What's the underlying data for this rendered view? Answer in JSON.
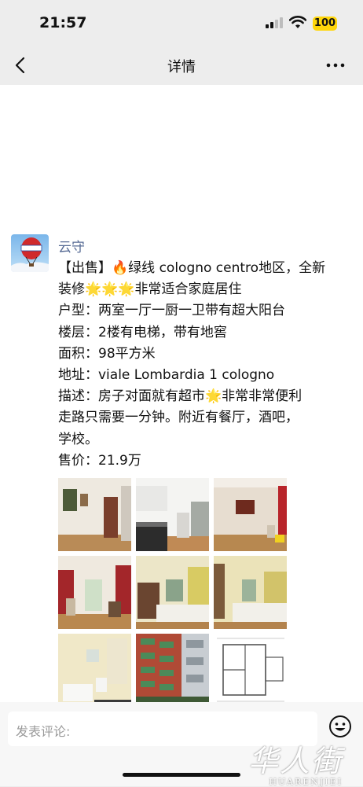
{
  "status_bar": {
    "time": "21:57",
    "battery": "100"
  },
  "nav": {
    "title": "详情"
  },
  "post": {
    "author": "云守",
    "lines": [
      "【出售】🔥绿线 cologno centro地区，全新",
      "装修🌟🌟🌟非常适合家庭居住",
      "户型：两室一厅一厨一卫带有超大阳台",
      "楼层：2楼有电梯，带有地窖",
      "面积：98平方米",
      "地址：viale Lombardia 1 cologno",
      "描述：房子对面就有超市🌟非常非常便利",
      "走路只需要一分钟。附近有餐厅，酒吧，",
      "学校。",
      "售价：21.9万"
    ],
    "photos": [
      "hallway-photo",
      "kitchen-photo",
      "living-room-photo",
      "red-room-photo",
      "bedroom-photo",
      "bedroom-2-photo",
      "bathroom-photo",
      "building-exterior-photo",
      "floor-plan-photo"
    ]
  },
  "bottom": {
    "comment_placeholder": "发表评论:"
  },
  "watermark": {
    "cn": "华人街",
    "en": "HUARENJIEI"
  }
}
